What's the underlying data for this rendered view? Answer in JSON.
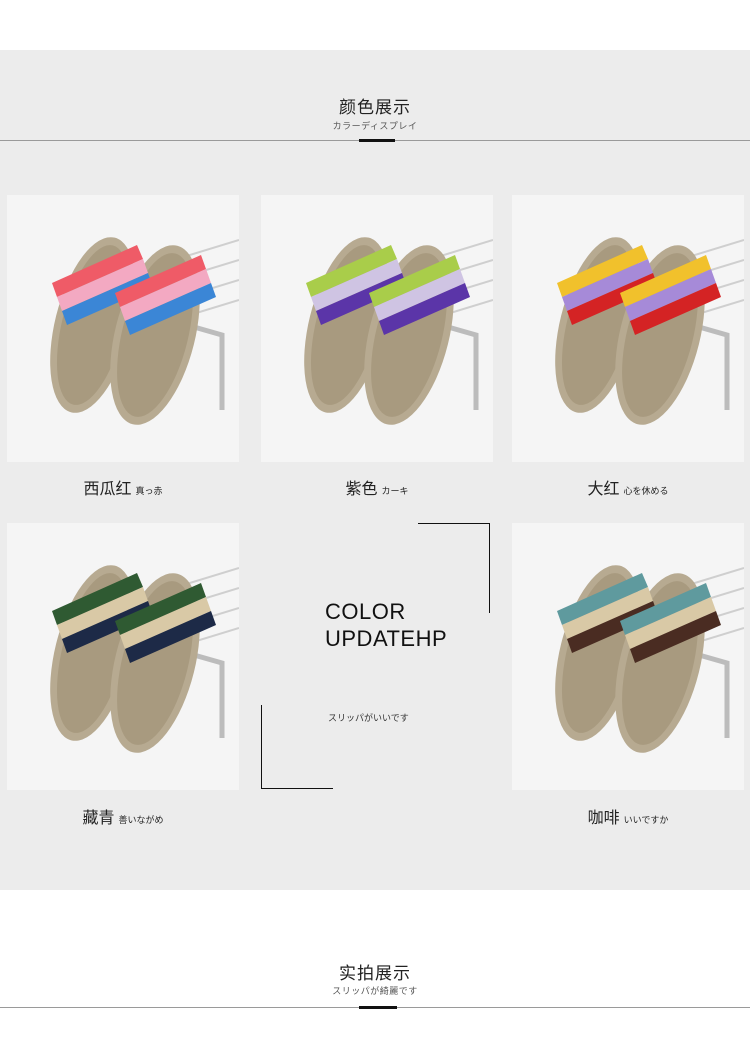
{
  "header": {
    "title": "颜色展示",
    "subtitle": "カラーディスプレイ"
  },
  "products": [
    {
      "name": "西瓜红",
      "sub": "真っ赤",
      "colors": {
        "toe": "#ef5b67",
        "mid": "#f3a9c2",
        "base": "#3b86d6"
      }
    },
    {
      "name": "紫色",
      "sub": "カーキ",
      "colors": {
        "toe": "#a9cd4a",
        "mid": "#cfc4e3",
        "base": "#5b35a8"
      }
    },
    {
      "name": "大红",
      "sub": "心を休める",
      "colors": {
        "toe": "#f1c12c",
        "mid": "#a68ad8",
        "base": "#d42324"
      }
    },
    {
      "name": "藏青",
      "sub": "善いながめ",
      "colors": {
        "toe": "#2f5a32",
        "mid": "#d9c9a6",
        "base": "#1d2a47"
      }
    },
    {
      "name": "咖啡",
      "sub": "いいですか",
      "colors": {
        "toe": "#5f9a9e",
        "mid": "#d9c9a6",
        "base": "#4a2c22"
      }
    }
  ],
  "center": {
    "title_line1": "COLOR",
    "title_line2": "UPDATEHP",
    "subtitle": "スリッパがいいです"
  },
  "footer_section": {
    "title": "实拍展示",
    "subtitle": "スリッパが綺麗です"
  }
}
